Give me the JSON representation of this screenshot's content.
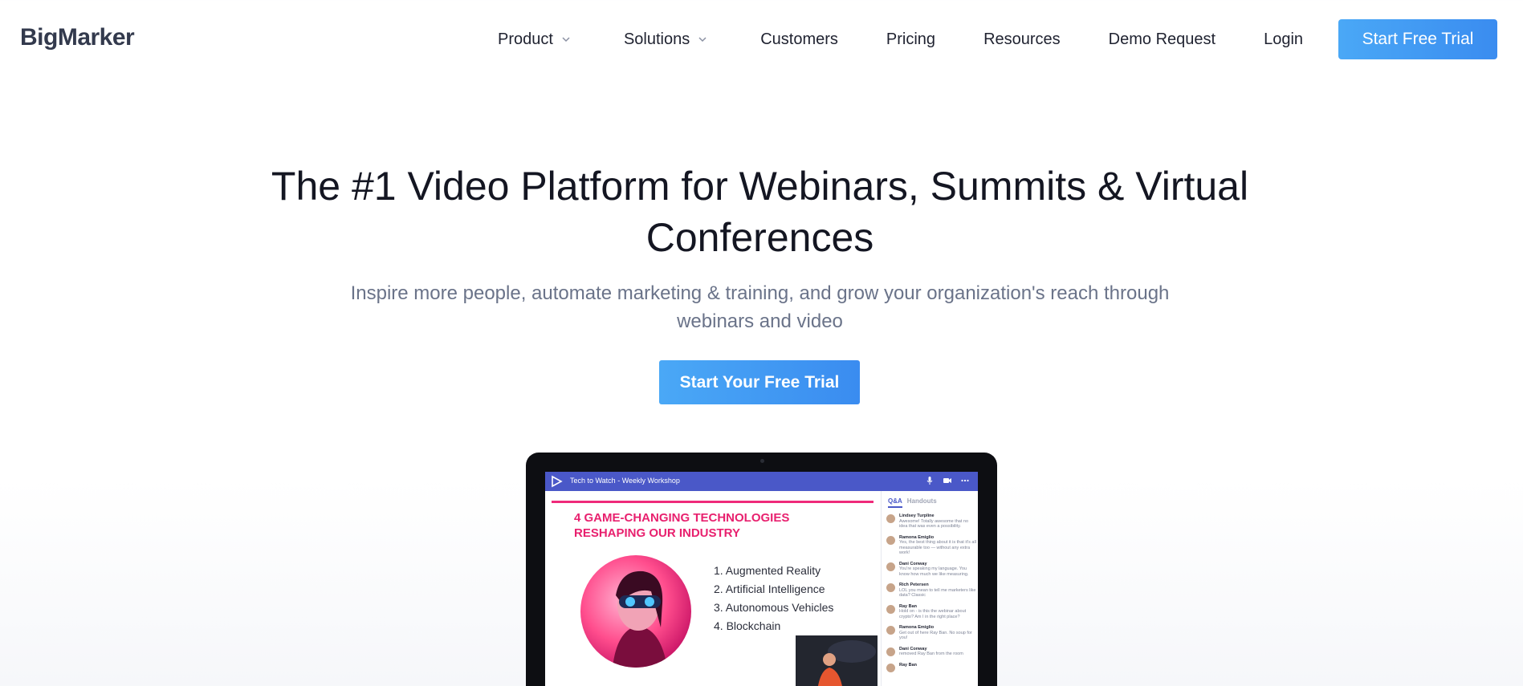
{
  "header": {
    "logo": "BigMarker",
    "nav": [
      {
        "label": "Product",
        "has_dropdown": true
      },
      {
        "label": "Solutions",
        "has_dropdown": true
      },
      {
        "label": "Customers",
        "has_dropdown": false
      },
      {
        "label": "Pricing",
        "has_dropdown": false
      },
      {
        "label": "Resources",
        "has_dropdown": false
      },
      {
        "label": "Demo Request",
        "has_dropdown": false
      },
      {
        "label": "Login",
        "has_dropdown": false
      }
    ],
    "cta_label": "Start Free Trial"
  },
  "hero": {
    "title": "The #1 Video Platform for Webinars, Summits & Virtual Conferences",
    "subtitle": "Inspire more people, automate marketing & training, and grow your organization's reach through webinars and video",
    "cta_label": "Start Your Free Trial"
  },
  "mockup": {
    "app_title": "Tech to Watch - Weekly Workshop",
    "slide_heading": "4 GAME-CHANGING TECHNOLOGIES RESHAPING OUR INDUSTRY",
    "slide_list": [
      "1. Augmented Reality",
      "2. Artificial Intelligence",
      "3. Autonomous Vehicles",
      "4. Blockchain"
    ],
    "tabs": {
      "qa": "Q&A",
      "handouts": "Handouts"
    },
    "messages": [
      {
        "name": "Lindsey Turpline",
        "text": "Awesome! Totally awesome that no idea that was even a possibility."
      },
      {
        "name": "Ramona Emiglio",
        "text": "Yes, the best thing about it is that it's all measurable too — without any extra work!"
      },
      {
        "name": "Dani Conway",
        "text": "You're speaking my language. You know how much we like measuring."
      },
      {
        "name": "Rich Petersen",
        "text": "LOL you mean to tell me marketers like data? Classic"
      },
      {
        "name": "Ray Ban",
        "text": "Hold on - is this the webinar about crypto? Am I in the right place?"
      },
      {
        "name": "Ramona Emiglio",
        "text": "Get out of here Ray Ban. No soup for you!"
      },
      {
        "name": "Dani Conway",
        "text": "removed Ray Ban from the room"
      },
      {
        "name": "Ray Ban",
        "text": ""
      }
    ]
  },
  "colors": {
    "accent": "#3a8cf0",
    "brand_pink": "#e8206e",
    "app_bar": "#4a58c8"
  }
}
